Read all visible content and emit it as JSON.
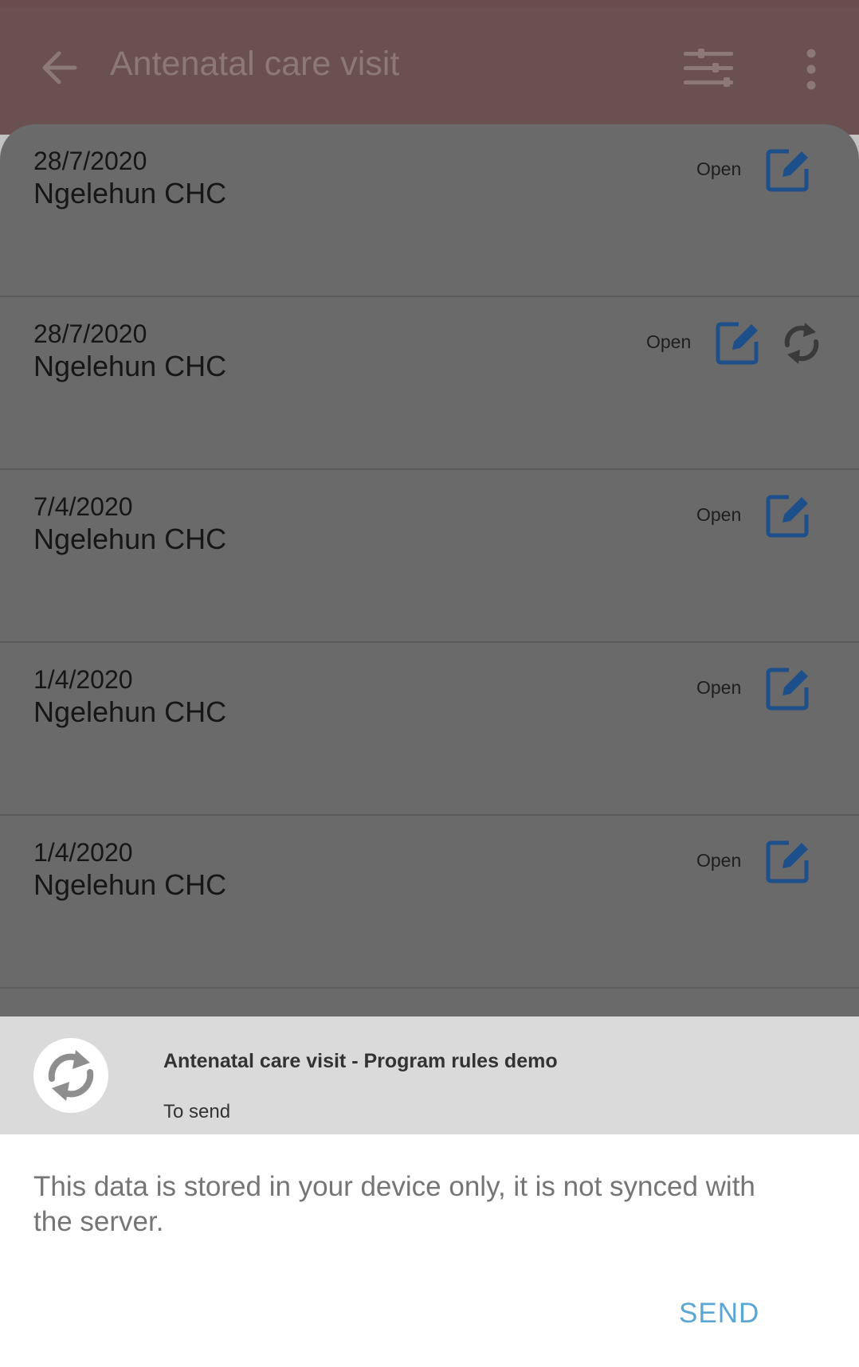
{
  "toolbar": {
    "title": "Antenatal care visit",
    "back_icon": "arrow-back-icon",
    "filter_icon": "filter-icon",
    "more_icon": "more-vert-icon"
  },
  "events": [
    {
      "date": "28/7/2020",
      "org_unit": "Ngelehun CHC",
      "status": "Open",
      "synced": true
    },
    {
      "date": "28/7/2020",
      "org_unit": "Ngelehun CHC",
      "status": "Open",
      "synced": false
    },
    {
      "date": "7/4/2020",
      "org_unit": "Ngelehun CHC",
      "status": "Open",
      "synced": true
    },
    {
      "date": "1/4/2020",
      "org_unit": "Ngelehun CHC",
      "status": "Open",
      "synced": true
    },
    {
      "date": "1/4/2020",
      "org_unit": "Ngelehun CHC",
      "status": "Open",
      "synced": true
    }
  ],
  "sync_dialog": {
    "title": "Antenatal care visit - Program rules demo",
    "state": "To send",
    "message": "This data is stored in your device only, it is not synced with the server.",
    "send_label": "SEND"
  },
  "colors": {
    "toolbar": "#6b5051",
    "list_background": "#6a6a6a",
    "edit_icon": "#1d4f8a",
    "send_button": "#5aa7d6"
  }
}
